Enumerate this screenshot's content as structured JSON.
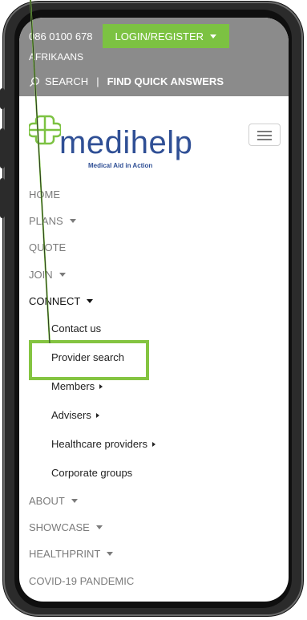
{
  "topbar": {
    "phone": "086 0100 678",
    "login_label": "LOGIN/REGISTER",
    "language": "AFRIKAANS",
    "search_label": "SEARCH",
    "divider": "|",
    "quick_answers": "FIND QUICK ANSWERS"
  },
  "logo": {
    "name": "medihelp",
    "tagline": "Medical Aid in Action"
  },
  "nav": {
    "items": [
      {
        "label": "HOME"
      },
      {
        "label": "PLANS"
      },
      {
        "label": "QUOTE"
      },
      {
        "label": "JOIN"
      },
      {
        "label": "CONNECT"
      }
    ],
    "connect_sub": [
      {
        "label": "Contact us"
      },
      {
        "label": "Provider search"
      },
      {
        "label": "Members"
      },
      {
        "label": "Advisers"
      },
      {
        "label": "Healthcare providers"
      },
      {
        "label": "Corporate groups"
      }
    ],
    "more": [
      {
        "label": "ABOUT"
      },
      {
        "label": "SHOWCASE"
      },
      {
        "label": "HEALTHPRINT"
      },
      {
        "label": "COVID-19 PANDEMIC"
      }
    ]
  },
  "colors": {
    "accent_green": "#7cc242",
    "brand_blue": "#2f4f95",
    "topbar_gray": "#8b8b8b"
  }
}
